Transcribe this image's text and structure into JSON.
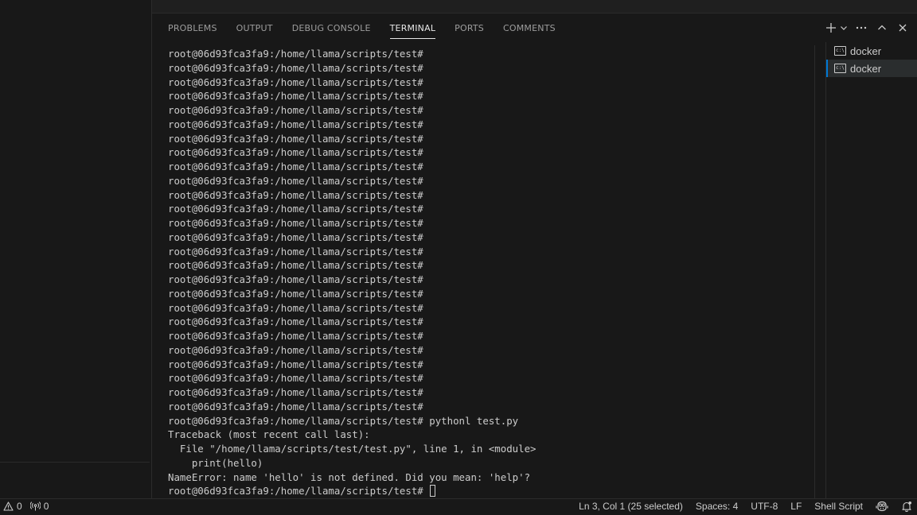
{
  "panel": {
    "tabs": [
      {
        "label": "PROBLEMS"
      },
      {
        "label": "OUTPUT"
      },
      {
        "label": "DEBUG CONSOLE"
      },
      {
        "label": "TERMINAL",
        "active": true
      },
      {
        "label": "PORTS"
      },
      {
        "label": "COMMENTS"
      }
    ],
    "actions": [
      "plus-icon",
      "chevron-down-icon",
      "ellipsis-icon",
      "chevron-up-icon",
      "close-icon"
    ]
  },
  "terminal": {
    "lines": [
      "root@06d93fca3fa9:/home/llama/scripts/test#",
      "root@06d93fca3fa9:/home/llama/scripts/test#",
      "root@06d93fca3fa9:/home/llama/scripts/test#",
      "root@06d93fca3fa9:/home/llama/scripts/test#",
      "root@06d93fca3fa9:/home/llama/scripts/test#",
      "root@06d93fca3fa9:/home/llama/scripts/test#",
      "root@06d93fca3fa9:/home/llama/scripts/test#",
      "root@06d93fca3fa9:/home/llama/scripts/test#",
      "root@06d93fca3fa9:/home/llama/scripts/test#",
      "root@06d93fca3fa9:/home/llama/scripts/test#",
      "root@06d93fca3fa9:/home/llama/scripts/test#",
      "root@06d93fca3fa9:/home/llama/scripts/test#",
      "root@06d93fca3fa9:/home/llama/scripts/test#",
      "root@06d93fca3fa9:/home/llama/scripts/test#",
      "root@06d93fca3fa9:/home/llama/scripts/test#",
      "root@06d93fca3fa9:/home/llama/scripts/test#",
      "root@06d93fca3fa9:/home/llama/scripts/test#",
      "root@06d93fca3fa9:/home/llama/scripts/test#",
      "root@06d93fca3fa9:/home/llama/scripts/test#",
      "root@06d93fca3fa9:/home/llama/scripts/test#",
      "root@06d93fca3fa9:/home/llama/scripts/test#",
      "root@06d93fca3fa9:/home/llama/scripts/test#",
      "root@06d93fca3fa9:/home/llama/scripts/test#",
      "root@06d93fca3fa9:/home/llama/scripts/test#",
      "root@06d93fca3fa9:/home/llama/scripts/test#",
      "root@06d93fca3fa9:/home/llama/scripts/test#",
      "root@06d93fca3fa9:/home/llama/scripts/test# pythonl test.py",
      "Traceback (most recent call last):",
      "  File \"/home/llama/scripts/test/test.py\", line 1, in <module>",
      "    print(hello)",
      "NameError: name 'hello' is not defined. Did you mean: 'help'?"
    ],
    "prompt": "root@06d93fca3fa9:/home/llama/scripts/test# "
  },
  "terminal_list": [
    {
      "label": "docker",
      "selected": false
    },
    {
      "label": "docker",
      "selected": true
    }
  ],
  "statusbar": {
    "warnings": "0",
    "ports": "0",
    "cursor_position": "Ln 3, Col 1 (25 selected)",
    "indentation": "Spaces: 4",
    "encoding": "UTF-8",
    "eol": "LF",
    "language": "Shell Script"
  },
  "colors": {
    "background": "#181818",
    "text": "#cccccc",
    "accent": "#0078d4"
  }
}
